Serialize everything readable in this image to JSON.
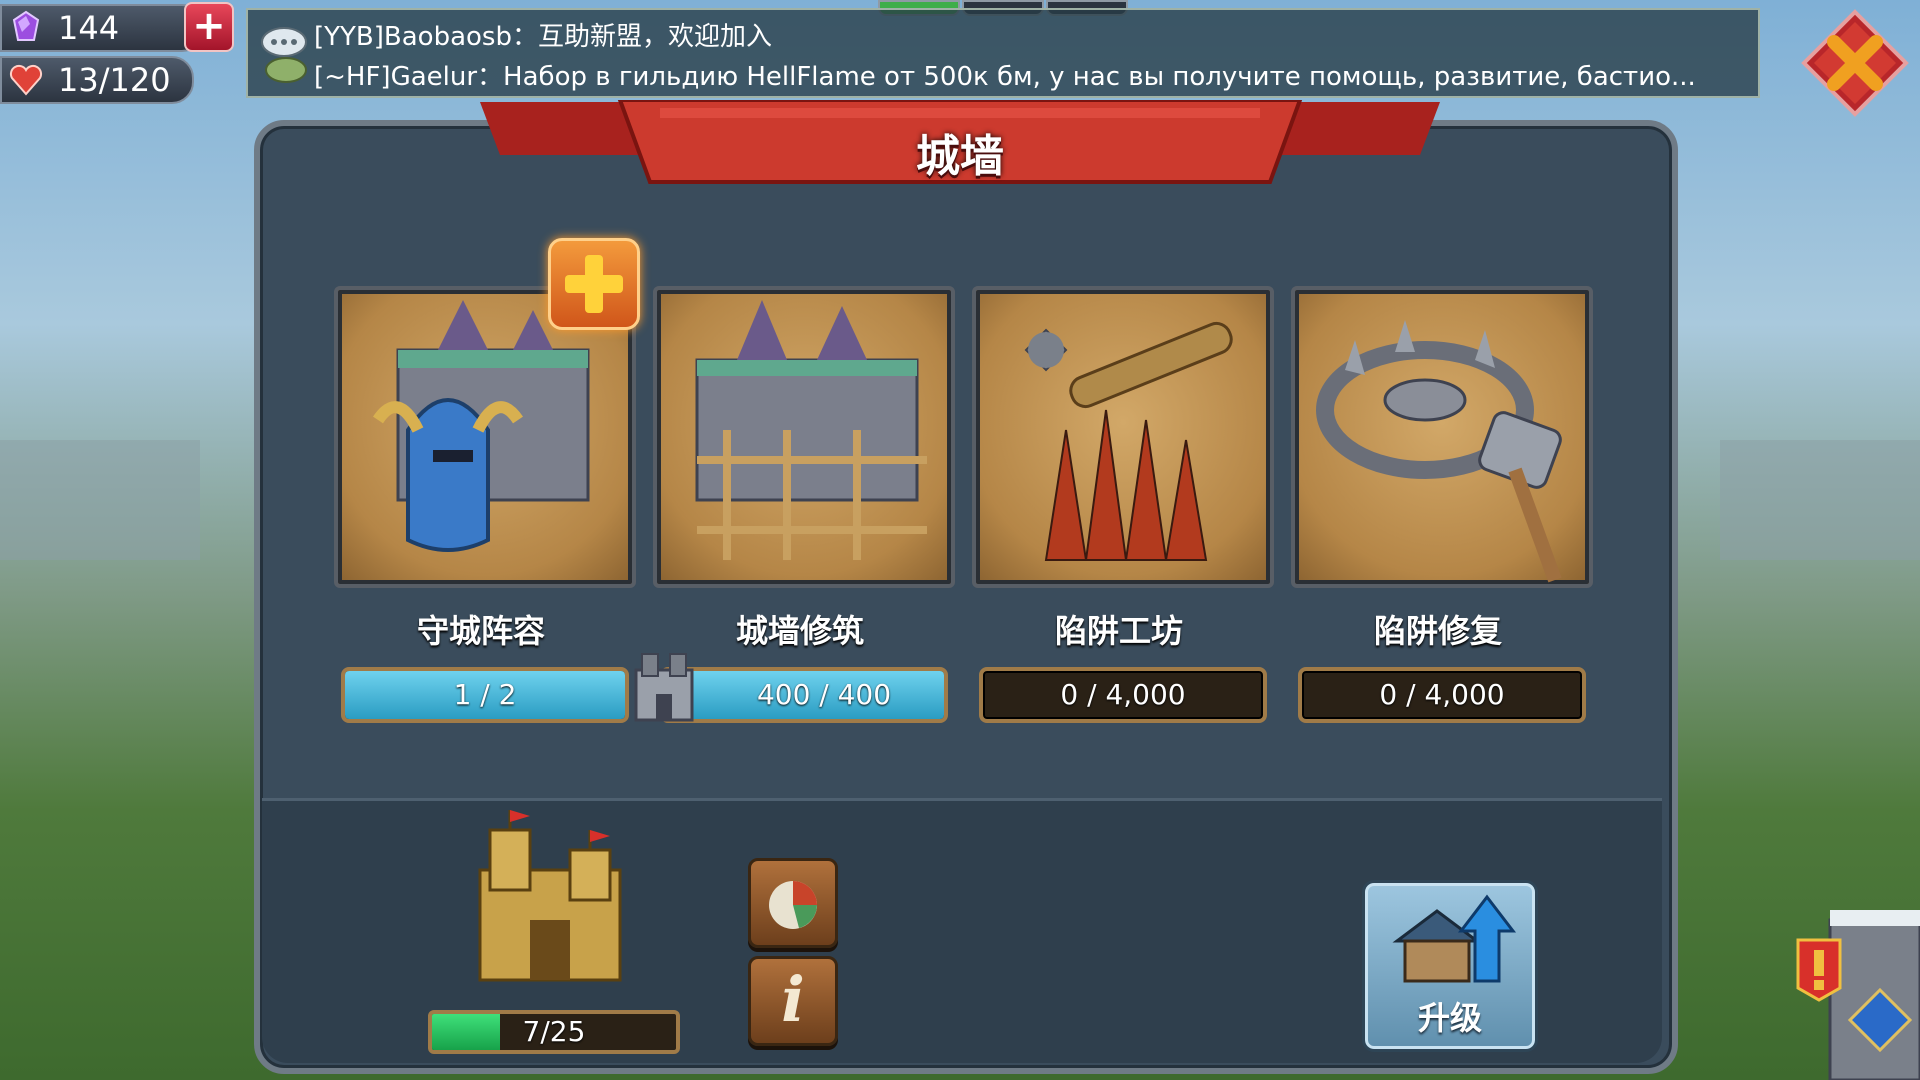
{
  "resources": {
    "gems": {
      "icon": "gem-icon",
      "value": "144"
    },
    "stamina": {
      "icon": "heart-icon",
      "value": "13/120"
    }
  },
  "chat": {
    "icon": "chat-bubble-icon",
    "messages": [
      {
        "text": "[YYB]Baobaosb：互助新盟，欢迎加入"
      },
      {
        "text": "[~HF]Gaelur：Набор в гильдию HellFlame от 500к бм, у нас вы получите помощь, развитие, бастио..."
      }
    ]
  },
  "panel": {
    "title": "城墙"
  },
  "cards": [
    {
      "id": "defense-lineup",
      "label": "守城阵容",
      "progress_text": "1 / 2",
      "fill": 1.0,
      "icon": "helmet-castle-icon"
    },
    {
      "id": "wall-repair",
      "label": "城墙修筑",
      "progress_text": "400 / 400",
      "fill": 1.0,
      "icon": "castle-scaffold-icon"
    },
    {
      "id": "trap-workshop",
      "label": "陷阱工坊",
      "progress_text": "0 / 4,000",
      "fill": 0.0,
      "icon": "spiked-trap-icon"
    },
    {
      "id": "trap-repair",
      "label": "陷阱修复",
      "progress_text": "0 / 4,000",
      "fill": 0.0,
      "icon": "bear-trap-hammer-icon"
    }
  ],
  "building": {
    "icon": "castle-building-icon",
    "level_text": "7/25",
    "level_fill": 0.28
  },
  "buttons": {
    "stats": {
      "icon": "pie-chart-icon"
    },
    "info": {
      "icon": "info-icon",
      "label": "i"
    },
    "upgrade": {
      "icon": "upgrade-house-icon",
      "label": "升级"
    },
    "close": {
      "icon": "close-x-icon"
    }
  },
  "colors": {
    "progress_blue": "#2a9cc2",
    "level_green": "#17a24a",
    "banner_red": "#c8342e"
  }
}
